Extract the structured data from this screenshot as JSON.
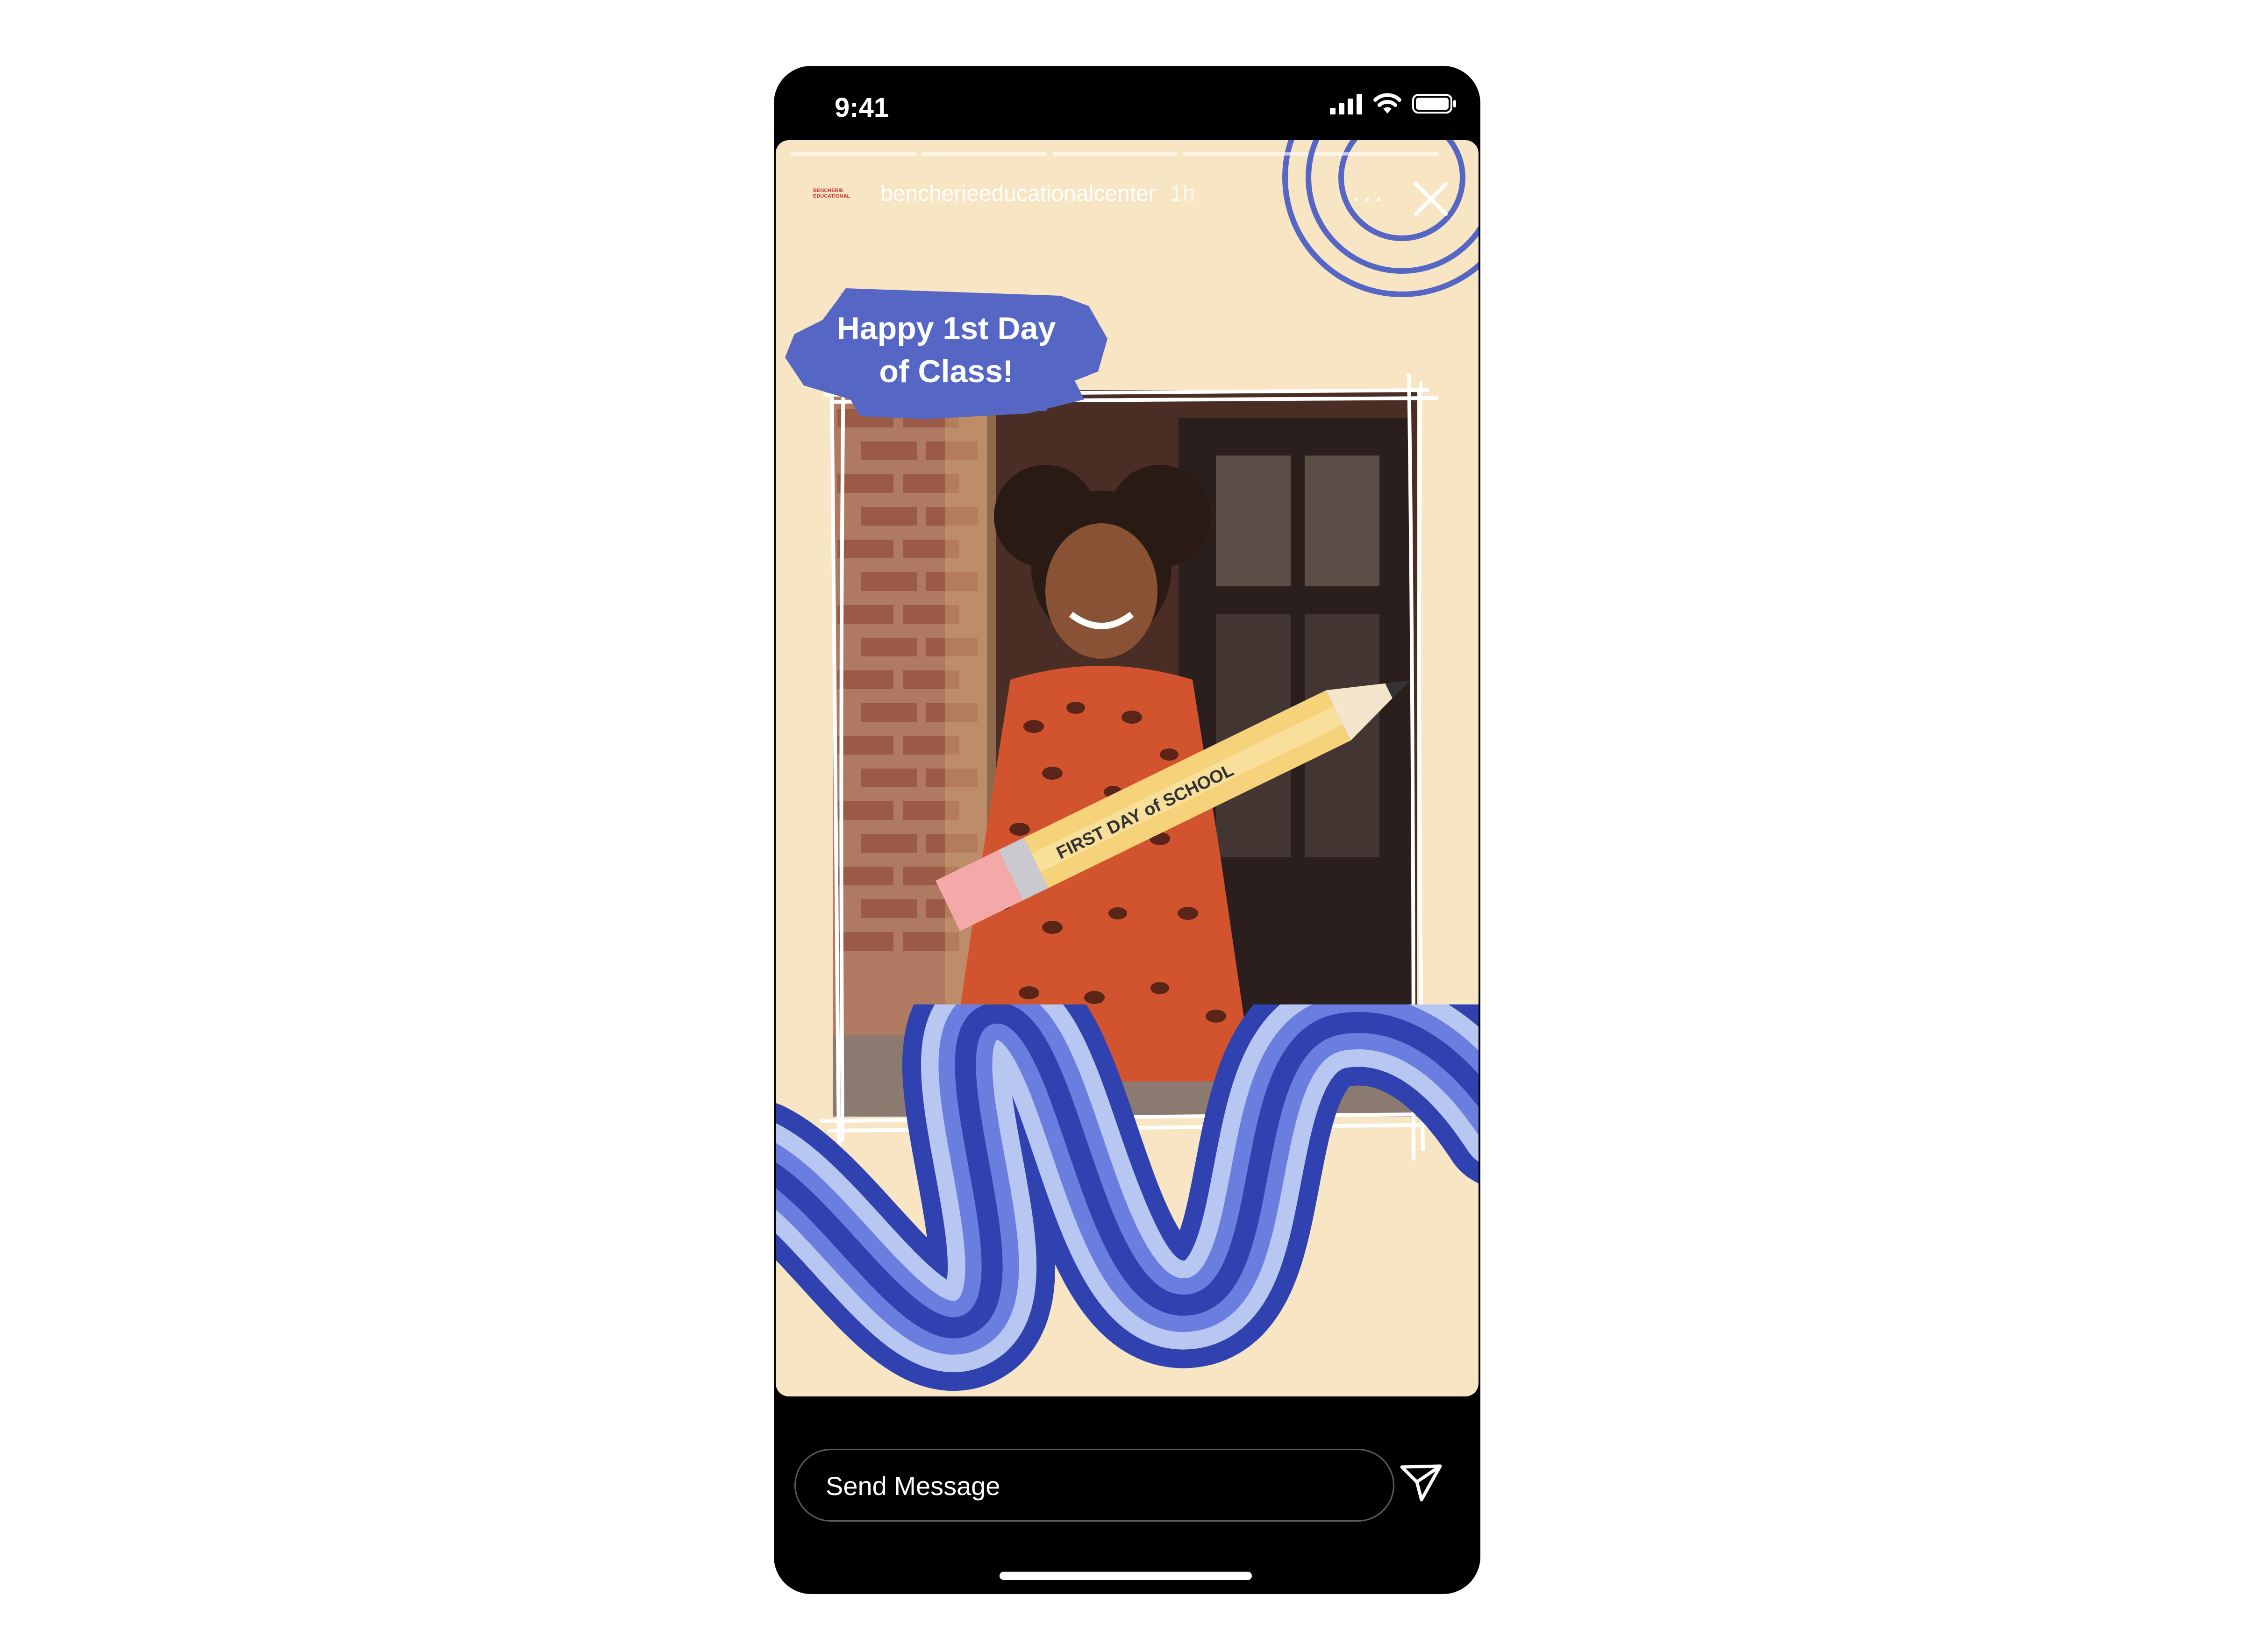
{
  "status_bar": {
    "time": "9:41",
    "icons": [
      "cellular-signal-icon",
      "wifi-icon",
      "battery-icon"
    ]
  },
  "story": {
    "progress_segments": 5,
    "account": {
      "avatar_logo_text": "BENCHERIE EDUCATIONAL",
      "username": "bencherieeducationalcenter",
      "time_ago": "1h"
    },
    "more_label": "···",
    "headline_line1": "Happy 1st Day",
    "headline_line2": "of Class!",
    "pencil_text": "FIRST DAY of SCHOOL",
    "colors": {
      "background": "#f8e5c4",
      "brush": "#5566c4",
      "wave_dark": "#3042b0",
      "wave_mid": "#6a7ee0",
      "wave_light": "#b8c6f2"
    }
  },
  "footer": {
    "message_placeholder": "Send Message",
    "send_icon": "paper-plane-icon"
  }
}
